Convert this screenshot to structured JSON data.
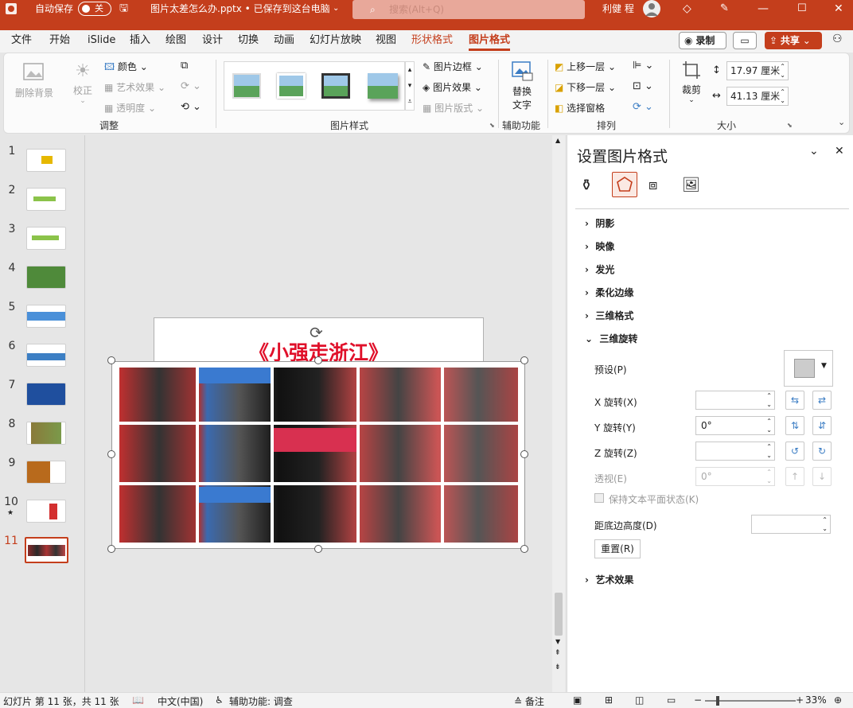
{
  "titlebar": {
    "autosave_label": "自动保存",
    "autosave_state": "关",
    "doc_title": "图片太差怎么办.pptx • 已保存到这台电脑",
    "search_placeholder": "搜索(Alt+Q)",
    "user_name": "利健 程"
  },
  "menu": {
    "tabs": [
      "文件",
      "开始",
      "iSlide",
      "插入",
      "绘图",
      "设计",
      "切换",
      "动画",
      "幻灯片放映",
      "视图",
      "形状格式",
      "图片格式"
    ],
    "record_label": "录制",
    "share_label": "共享"
  },
  "ribbon": {
    "adjust": {
      "remove_bg": "删除背景",
      "corrections": "校正",
      "color": "颜色",
      "art_effects": "艺术效果",
      "transparency": "透明度",
      "group_label": "调整"
    },
    "styles": {
      "border": "图片边框",
      "effects": "图片效果",
      "layout": "图片版式",
      "group_label": "图片样式"
    },
    "accessibility": {
      "alt_text_line1": "替换",
      "alt_text_line2": "文字",
      "group_label": "辅助功能"
    },
    "arrange": {
      "bring_forward": "上移一层",
      "send_backward": "下移一层",
      "selection_pane": "选择窗格",
      "group_label": "排列"
    },
    "size": {
      "crop": "裁剪",
      "height": "17.97 厘米",
      "width": "41.13 厘米",
      "group_label": "大小"
    }
  },
  "thumbnails": [
    {
      "num": "1"
    },
    {
      "num": "2"
    },
    {
      "num": "3"
    },
    {
      "num": "4"
    },
    {
      "num": "5"
    },
    {
      "num": "6"
    },
    {
      "num": "7"
    },
    {
      "num": "8"
    },
    {
      "num": "9"
    },
    {
      "num": "10"
    },
    {
      "num": "11"
    }
  ],
  "slide": {
    "title": "《小强走浙江》"
  },
  "pane": {
    "title": "设置图片格式",
    "sections": [
      "阴影",
      "映像",
      "发光",
      "柔化边缘",
      "三维格式",
      "三维旋转"
    ],
    "rotation": {
      "preset_label": "预设(P)",
      "x_label": "X 旋转(X)",
      "x_value": "",
      "y_label": "Y 旋转(Y)",
      "y_value": "0°",
      "z_label": "Z 旋转(Z)",
      "z_value": "",
      "perspective_label": "透视(E)",
      "perspective_value": "0°",
      "keep_text_flat": "保持文本平面状态(K)",
      "distance_label": "距底边高度(D)",
      "distance_value": "",
      "reset_label": "重置(R)"
    },
    "art_section": "艺术效果"
  },
  "status": {
    "slide_info": "幻灯片 第 11 张，共 11 张",
    "language": "中文(中国)",
    "accessibility": "辅助功能: 调查",
    "notes": "备注",
    "zoom": "33%"
  },
  "colors": {
    "brand": "#c43e1c",
    "title_red": "#e0102a",
    "active_tab": "#c43e1c"
  }
}
